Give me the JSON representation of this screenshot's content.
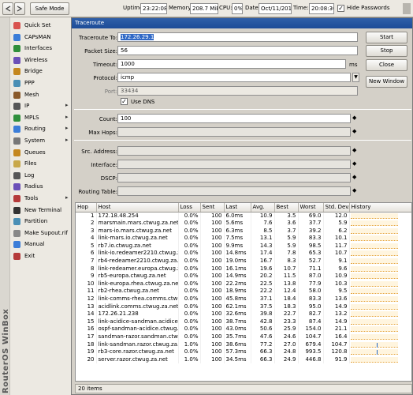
{
  "topbar": {
    "undo_icon": "undo-arrow-icon",
    "redo_icon": "redo-arrow-icon",
    "safe_mode_label": "Safe Mode",
    "uptime_label": "Uptime:",
    "uptime_value": "23:22:08",
    "memory_label": "Memory:",
    "memory_value": "208.7 MiB",
    "cpu_label": "CPU:",
    "cpu_value": "0%",
    "date_label": "Date:",
    "date_value": "Oct/11/2018",
    "time_label": "Time:",
    "time_value": "20:08:30",
    "hide_passwords_label": "Hide Passwords",
    "hide_passwords_checked": true
  },
  "sidebar": {
    "brand": "RouterOS WinBox",
    "items": [
      {
        "label": "Quick Set",
        "icon": "quick-set-icon",
        "submenu": false
      },
      {
        "label": "CAPsMAN",
        "icon": "capsman-icon",
        "submenu": false
      },
      {
        "label": "Interfaces",
        "icon": "interfaces-icon",
        "submenu": false
      },
      {
        "label": "Wireless",
        "icon": "wireless-icon",
        "submenu": false
      },
      {
        "label": "Bridge",
        "icon": "bridge-icon",
        "submenu": false
      },
      {
        "label": "PPP",
        "icon": "ppp-icon",
        "submenu": false
      },
      {
        "label": "Mesh",
        "icon": "mesh-icon",
        "submenu": false
      },
      {
        "label": "IP",
        "icon": "ip-icon",
        "submenu": true
      },
      {
        "label": "MPLS",
        "icon": "mpls-icon",
        "submenu": true
      },
      {
        "label": "Routing",
        "icon": "routing-icon",
        "submenu": true
      },
      {
        "label": "System",
        "icon": "system-icon",
        "submenu": true
      },
      {
        "label": "Queues",
        "icon": "queues-icon",
        "submenu": false
      },
      {
        "label": "Files",
        "icon": "files-icon",
        "submenu": false
      },
      {
        "label": "Log",
        "icon": "log-icon",
        "submenu": false
      },
      {
        "label": "Radius",
        "icon": "radius-icon",
        "submenu": false
      },
      {
        "label": "Tools",
        "icon": "tools-icon",
        "submenu": true
      },
      {
        "label": "New Terminal",
        "icon": "terminal-icon",
        "submenu": false
      },
      {
        "label": "Partition",
        "icon": "partition-icon",
        "submenu": false
      },
      {
        "label": "Make Supout.rif",
        "icon": "supout-icon",
        "submenu": false
      },
      {
        "label": "Manual",
        "icon": "manual-icon",
        "submenu": false
      },
      {
        "label": "Exit",
        "icon": "exit-icon",
        "submenu": false
      }
    ]
  },
  "window": {
    "title": "Traceroute",
    "fields": {
      "traceroute_to": {
        "label": "Traceroute To:",
        "value": "172.26.29.1"
      },
      "packet_size": {
        "label": "Packet Size:",
        "value": "56"
      },
      "timeout": {
        "label": "Timeout:",
        "value": "1000",
        "unit": "ms"
      },
      "protocol": {
        "label": "Protocol:",
        "value": "icmp"
      },
      "port": {
        "label": "Port:",
        "value": "33434"
      },
      "use_dns": {
        "label": "Use DNS",
        "checked": true
      },
      "count": {
        "label": "Count:",
        "value": "100"
      },
      "max_hops": {
        "label": "Max Hops:",
        "value": ""
      },
      "src_address": {
        "label": "Src. Address:",
        "value": ""
      },
      "interface": {
        "label": "Interface:",
        "value": ""
      },
      "dscp": {
        "label": "DSCP:",
        "value": ""
      },
      "routing_table": {
        "label": "Routing Table:",
        "value": ""
      }
    },
    "buttons": {
      "start": "Start",
      "stop": "Stop",
      "close": "Close",
      "new_window": "New Window"
    },
    "table": {
      "columns": [
        "Hop",
        "Host",
        "Loss",
        "Sent",
        "Last",
        "Avg.",
        "Best",
        "Worst",
        "Std. Dev.",
        "History"
      ],
      "rows": [
        {
          "hop": "1",
          "host": "172.18.48.254",
          "loss": "0.0%",
          "sent": "100",
          "last": "6.0ms",
          "avg": "10.9",
          "best": "3.5",
          "worst": "69.0",
          "stddev": "12.0",
          "history": []
        },
        {
          "hop": "2",
          "host": "marsmain.mars.ctwug.za.net",
          "loss": "0.0%",
          "sent": "100",
          "last": "5.6ms",
          "avg": "7.6",
          "best": "3.6",
          "worst": "37.7",
          "stddev": "5.9",
          "history": []
        },
        {
          "hop": "3",
          "host": "mars-io.mars.ctwug.za.net",
          "loss": "0.0%",
          "sent": "100",
          "last": "6.3ms",
          "avg": "8.5",
          "best": "3.7",
          "worst": "39.2",
          "stddev": "6.2",
          "history": []
        },
        {
          "hop": "4",
          "host": "link-mars.io.ctwug.za.net",
          "loss": "0.0%",
          "sent": "100",
          "last": "7.5ms",
          "avg": "13.1",
          "best": "5.9",
          "worst": "83.3",
          "stddev": "10.1",
          "history": []
        },
        {
          "hop": "5",
          "host": "rb7.io.ctwug.za.net",
          "loss": "0.0%",
          "sent": "100",
          "last": "9.9ms",
          "avg": "14.3",
          "best": "5.9",
          "worst": "98.5",
          "stddev": "11.7",
          "history": []
        },
        {
          "hop": "6",
          "host": "link-io.redeamer2210.ctwug.za.net",
          "loss": "0.0%",
          "sent": "100",
          "last": "14.8ms",
          "avg": "17.4",
          "best": "7.8",
          "worst": "65.3",
          "stddev": "10.7",
          "history": []
        },
        {
          "hop": "7",
          "host": "rb4-redeamer2210.ctwug.za.net",
          "loss": "0.0%",
          "sent": "100",
          "last": "19.0ms",
          "avg": "16.7",
          "best": "8.3",
          "worst": "52.7",
          "stddev": "9.1",
          "history": []
        },
        {
          "hop": "8",
          "host": "link-redeamer.europa.ctwug.za.net",
          "loss": "0.0%",
          "sent": "100",
          "last": "16.1ms",
          "avg": "19.6",
          "best": "10.7",
          "worst": "71.1",
          "stddev": "9.6",
          "history": []
        },
        {
          "hop": "9",
          "host": "rb5-europa.ctwug.za.net",
          "loss": "0.0%",
          "sent": "100",
          "last": "14.9ms",
          "avg": "20.2",
          "best": "11.5",
          "worst": "87.0",
          "stddev": "10.9",
          "history": []
        },
        {
          "hop": "10",
          "host": "link-europa.rhea.ctwug.za.net",
          "loss": "0.0%",
          "sent": "100",
          "last": "22.2ms",
          "avg": "22.5",
          "best": "13.8",
          "worst": "77.9",
          "stddev": "10.3",
          "history": []
        },
        {
          "hop": "11",
          "host": "rb2-rhea.ctwug.za.net",
          "loss": "0.0%",
          "sent": "100",
          "last": "18.9ms",
          "avg": "22.2",
          "best": "12.4",
          "worst": "58.0",
          "stddev": "9.5",
          "history": []
        },
        {
          "hop": "12",
          "host": "link-comms-rhea.comms.ctwug.za.net",
          "loss": "0.0%",
          "sent": "100",
          "last": "45.8ms",
          "avg": "37.1",
          "best": "18.4",
          "worst": "83.3",
          "stddev": "13.6",
          "history": []
        },
        {
          "hop": "13",
          "host": "acidlink.comms.ctwug.za.net",
          "loss": "0.0%",
          "sent": "100",
          "last": "62.1ms",
          "avg": "37.5",
          "best": "18.3",
          "worst": "95.0",
          "stddev": "14.9",
          "history": []
        },
        {
          "hop": "14",
          "host": "172.26.21.238",
          "loss": "0.0%",
          "sent": "100",
          "last": "32.6ms",
          "avg": "39.8",
          "best": "22.7",
          "worst": "82.7",
          "stddev": "13.2",
          "history": []
        },
        {
          "hop": "15",
          "host": "link-acidice-sandman.acidice.ctwug.za.net",
          "loss": "0.0%",
          "sent": "100",
          "last": "38.7ms",
          "avg": "42.8",
          "best": "23.3",
          "worst": "87.4",
          "stddev": "14.9",
          "history": []
        },
        {
          "hop": "16",
          "host": "ospf-sandman-acidice.ctwug.za.net",
          "loss": "0.0%",
          "sent": "100",
          "last": "43.0ms",
          "avg": "50.6",
          "best": "25.9",
          "worst": "154.0",
          "stddev": "21.1",
          "history": []
        },
        {
          "hop": "17",
          "host": "sandman-razor.sandman.ctwug.za.net",
          "loss": "0.0%",
          "sent": "100",
          "last": "35.7ms",
          "avg": "47.6",
          "best": "24.6",
          "worst": "104.7",
          "stddev": "16.4",
          "history": []
        },
        {
          "hop": "18",
          "host": "link-sandman.razor.ctwug.za.net",
          "loss": "1.0%",
          "sent": "100",
          "last": "38.6ms",
          "avg": "77.2",
          "best": "27.0",
          "worst": "679.4",
          "stddev": "104.7",
          "history": [
            0.55
          ]
        },
        {
          "hop": "19",
          "host": "rb3-core.razor.ctwug.za.net",
          "loss": "0.0%",
          "sent": "100",
          "last": "57.3ms",
          "avg": "66.3",
          "best": "24.8",
          "worst": "993.5",
          "stddev": "120.8",
          "history": [
            0.55
          ]
        },
        {
          "hop": "20",
          "host": "server.razor.ctwug.za.net",
          "loss": "1.0%",
          "sent": "100",
          "last": "34.5ms",
          "avg": "66.3",
          "best": "24.9",
          "worst": "446.8",
          "stddev": "91.9",
          "history": []
        }
      ]
    },
    "status": "20 items"
  }
}
